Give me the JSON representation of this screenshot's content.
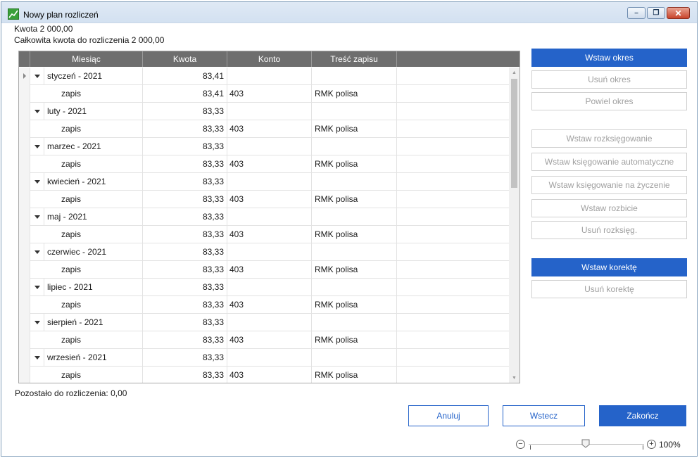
{
  "window": {
    "title": "Nowy plan rozliczeń",
    "buttons": {
      "minimize": "–",
      "restore": "❐",
      "close": "✕"
    }
  },
  "info": {
    "amount": "Kwota 2 000,00",
    "total": "Całkowita kwota do rozliczenia 2 000,00"
  },
  "grid": {
    "headers": [
      "Miesiąc",
      "Kwota",
      "Konto",
      "Treść zapisu"
    ],
    "rows": [
      {
        "type": "period",
        "month": "styczeń - 2021",
        "amount": "83,41",
        "account": "",
        "desc": ""
      },
      {
        "type": "entry",
        "month": "zapis",
        "amount": "83,41",
        "account": "403",
        "desc": "RMK polisa"
      },
      {
        "type": "period",
        "month": "luty - 2021",
        "amount": "83,33",
        "account": "",
        "desc": ""
      },
      {
        "type": "entry",
        "month": "zapis",
        "amount": "83,33",
        "account": "403",
        "desc": "RMK polisa"
      },
      {
        "type": "period",
        "month": "marzec - 2021",
        "amount": "83,33",
        "account": "",
        "desc": ""
      },
      {
        "type": "entry",
        "month": "zapis",
        "amount": "83,33",
        "account": "403",
        "desc": "RMK polisa"
      },
      {
        "type": "period",
        "month": "kwiecień - 2021",
        "amount": "83,33",
        "account": "",
        "desc": ""
      },
      {
        "type": "entry",
        "month": "zapis",
        "amount": "83,33",
        "account": "403",
        "desc": "RMK polisa"
      },
      {
        "type": "period",
        "month": "maj - 2021",
        "amount": "83,33",
        "account": "",
        "desc": ""
      },
      {
        "type": "entry",
        "month": "zapis",
        "amount": "83,33",
        "account": "403",
        "desc": "RMK polisa"
      },
      {
        "type": "period",
        "month": "czerwiec - 2021",
        "amount": "83,33",
        "account": "",
        "desc": ""
      },
      {
        "type": "entry",
        "month": "zapis",
        "amount": "83,33",
        "account": "403",
        "desc": "RMK polisa"
      },
      {
        "type": "period",
        "month": "lipiec - 2021",
        "amount": "83,33",
        "account": "",
        "desc": ""
      },
      {
        "type": "entry",
        "month": "zapis",
        "amount": "83,33",
        "account": "403",
        "desc": "RMK polisa"
      },
      {
        "type": "period",
        "month": "sierpień - 2021",
        "amount": "83,33",
        "account": "",
        "desc": ""
      },
      {
        "type": "entry",
        "month": "zapis",
        "amount": "83,33",
        "account": "403",
        "desc": "RMK polisa"
      },
      {
        "type": "period",
        "month": "wrzesień - 2021",
        "amount": "83,33",
        "account": "",
        "desc": ""
      },
      {
        "type": "entry",
        "month": "zapis",
        "amount": "83,33",
        "account": "403",
        "desc": "RMK polisa"
      }
    ]
  },
  "side_buttons": {
    "insert_period": "Wstaw okres",
    "delete_period": "Usuń okres",
    "repeat_period": "Powiel okres",
    "insert_split": "Wstaw rozksięgowanie",
    "insert_auto_posting": "Wstaw księgowanie automatyczne",
    "insert_posting_on_demand": "Wstaw księgowanie na życzenie",
    "insert_breakdown": "Wstaw rozbicie",
    "delete_split": "Usuń rozksięg.",
    "insert_correction": "Wstaw korektę",
    "delete_correction": "Usuń korektę"
  },
  "footer": {
    "remaining": "Pozostało do rozliczenia: 0,00",
    "cancel": "Anuluj",
    "back": "Wstecz",
    "finish": "Zakończ"
  },
  "zoom": {
    "minus": "−",
    "plus": "+",
    "level": "100%"
  },
  "colors": {
    "accent": "#2563c9",
    "header": "#6e6e6e"
  }
}
